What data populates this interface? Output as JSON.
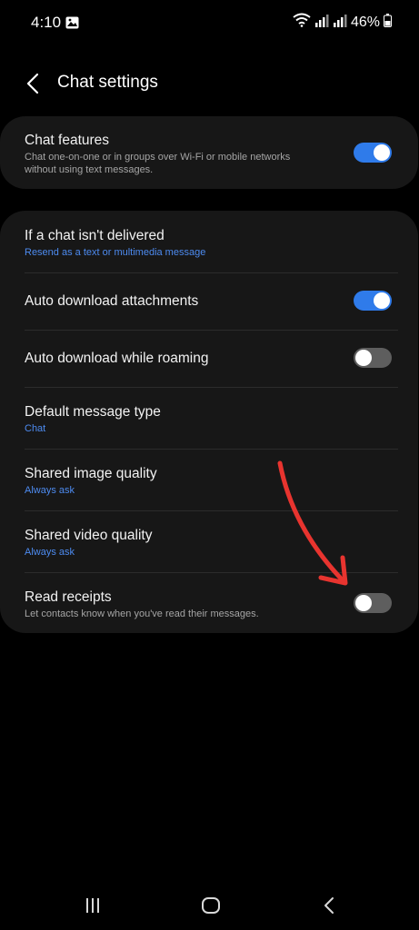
{
  "status_bar": {
    "time": "4:10",
    "battery": "46%"
  },
  "header": {
    "title": "Chat settings",
    "back_icon": "chevron-left-icon"
  },
  "chat_features": {
    "title": "Chat features",
    "subtitle_line1": "Chat one-on-one or in groups over Wi-Fi or mobile networks",
    "subtitle_line2": "without using text messages.",
    "toggle_on": true
  },
  "settings": {
    "undelivered": {
      "title": "If a chat isn't delivered",
      "value": "Resend as a text or multimedia message"
    },
    "auto_download": {
      "title": "Auto download attachments",
      "toggle_on": true
    },
    "roaming": {
      "title": "Auto download while roaming",
      "toggle_on": false
    },
    "default_type": {
      "title": "Default message type",
      "value": "Chat"
    },
    "image_quality": {
      "title": "Shared image quality",
      "value": "Always ask"
    },
    "video_quality": {
      "title": "Shared video quality",
      "value": "Always ask"
    },
    "read_receipts": {
      "title": "Read receipts",
      "subtitle": "Let contacts know when you've read their messages.",
      "toggle_on": false
    }
  },
  "colors": {
    "background": "#000000",
    "card": "#171717",
    "accent_blue": "#2f7bea",
    "link_blue": "#4d8bf0",
    "toggle_off": "#5e5e5e",
    "annotation_red": "#e8342f"
  },
  "nav_bar": {
    "recent_icon": "recent-apps-icon",
    "home_icon": "home-icon",
    "back_icon": "back-icon"
  }
}
